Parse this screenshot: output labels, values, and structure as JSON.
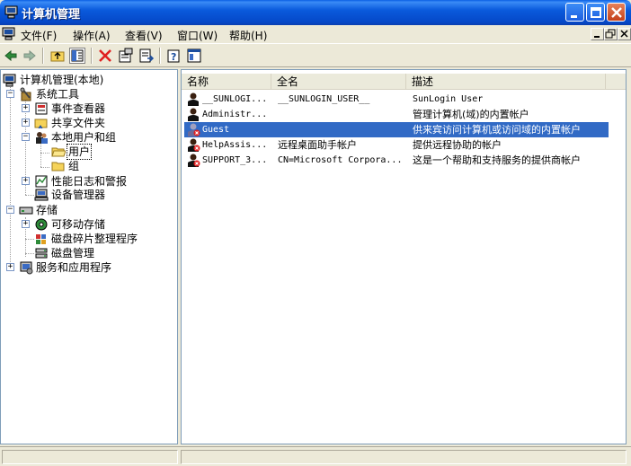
{
  "window": {
    "title": "计算机管理",
    "colors": {
      "title_bar": "#0a5adc",
      "selection": "#316ac5"
    }
  },
  "menu": {
    "items": [
      "文件(F)",
      "操作(A)",
      "查看(V)",
      "窗口(W)",
      "帮助(H)"
    ]
  },
  "toolbar": {
    "icons": [
      "back-arrow-icon",
      "forward-arrow-icon",
      "up-folder-icon",
      "show-hide-tree-icon",
      "delete-icon",
      "properties-icon",
      "export-list-icon",
      "help-icon",
      "console-pane-icon"
    ]
  },
  "tree": {
    "items": [
      {
        "label": "计算机管理(本地)",
        "icon": "computer-management-icon"
      },
      {
        "label": "系统工具",
        "icon": "system-tools-icon"
      },
      {
        "label": "事件查看器",
        "icon": "event-viewer-icon"
      },
      {
        "label": "共享文件夹",
        "icon": "shared-folder-icon"
      },
      {
        "label": "本地用户和组",
        "icon": "local-users-groups-icon"
      },
      {
        "label": "用户",
        "icon": "folder-icon"
      },
      {
        "label": "组",
        "icon": "folder-icon"
      },
      {
        "label": "性能日志和警报",
        "icon": "performance-logs-icon"
      },
      {
        "label": "设备管理器",
        "icon": "device-manager-icon"
      },
      {
        "label": "存储",
        "icon": "storage-icon"
      },
      {
        "label": "可移动存储",
        "icon": "removable-storage-icon"
      },
      {
        "label": "磁盘碎片整理程序",
        "icon": "defrag-icon"
      },
      {
        "label": "磁盘管理",
        "icon": "disk-management-icon"
      },
      {
        "label": "服务和应用程序",
        "icon": "services-apps-icon"
      }
    ]
  },
  "list": {
    "columns": [
      "名称",
      "全名",
      "描述"
    ],
    "rows": [
      {
        "name": "__SUNLOGI...",
        "fullname": "__SUNLOGIN_USER__",
        "description": "SunLogin User",
        "disabled": false
      },
      {
        "name": "Administr...",
        "fullname": "",
        "description": "管理计算机(域)的内置帐户",
        "disabled": false
      },
      {
        "name": "Guest",
        "fullname": "",
        "description": "供来宾访问计算机或访问域的内置帐户",
        "disabled": true
      },
      {
        "name": "HelpAssis...",
        "fullname": "远程桌面助手帐户",
        "description": "提供远程协助的帐户",
        "disabled": true
      },
      {
        "name": "SUPPORT_3...",
        "fullname": "CN=Microsoft Corpora...",
        "description": "这是一个帮助和支持服务的提供商帐户",
        "disabled": true
      }
    ]
  }
}
